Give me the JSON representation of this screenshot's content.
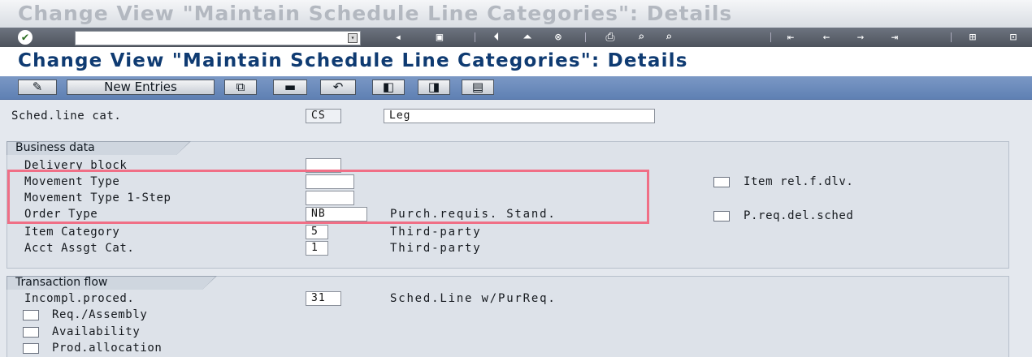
{
  "window": {
    "title": "Change View \"Maintain Schedule Line Categories\": Details"
  },
  "system_toolbar": {
    "command_field_value": "",
    "icons": [
      "enter-icon",
      "dropdown-icon",
      "back-arrow-icon",
      "save-icon",
      "back-icon",
      "exit-icon",
      "cancel-icon",
      "print-icon",
      "find-icon",
      "find-next-icon",
      "first-page-icon",
      "previous-page-icon",
      "next-page-icon",
      "last-page-icon",
      "create-session-icon",
      "shortcut-icon"
    ]
  },
  "heading": {
    "title": "Change View \"Maintain Schedule Line Categories\": Details"
  },
  "app_toolbar": {
    "new_entries_label": "New Entries"
  },
  "header": {
    "sched_line_cat_label": "Sched.line cat.",
    "sched_line_cat_value": "CS",
    "description_value": "Leg"
  },
  "business_data": {
    "title": "Business data",
    "delivery_block_label": "Delivery block",
    "delivery_block_value": "",
    "movement_type_label": "Movement Type",
    "movement_type_value": "",
    "movement_type_1step_label": "Movement Type 1-Step",
    "movement_type_1step_value": "",
    "order_type_label": "Order Type",
    "order_type_value": "NB",
    "order_type_desc": "Purch.requis. Stand.",
    "item_category_label": "Item Category",
    "item_category_value": "5",
    "item_category_desc": "Third-party",
    "acct_assgt_label": "Acct Assgt Cat.",
    "acct_assgt_value": "1",
    "acct_assgt_desc": "Third-party",
    "item_rel_label": "Item rel.f.dlv.",
    "preq_del_label": "P.req.del.sched"
  },
  "transaction_flow": {
    "title": "Transaction flow",
    "incompl_label": "Incompl.proced.",
    "incompl_value": "31",
    "incompl_desc": "Sched.Line w/PurReq.",
    "req_assembly_label": "Req./Assembly",
    "availability_label": "Availability",
    "prod_allocation_label": "Prod.allocation"
  },
  "colors": {
    "heading_text": "#0f3b72",
    "app_toolbar": "#6b8abb",
    "highlight": "#f06f86"
  }
}
